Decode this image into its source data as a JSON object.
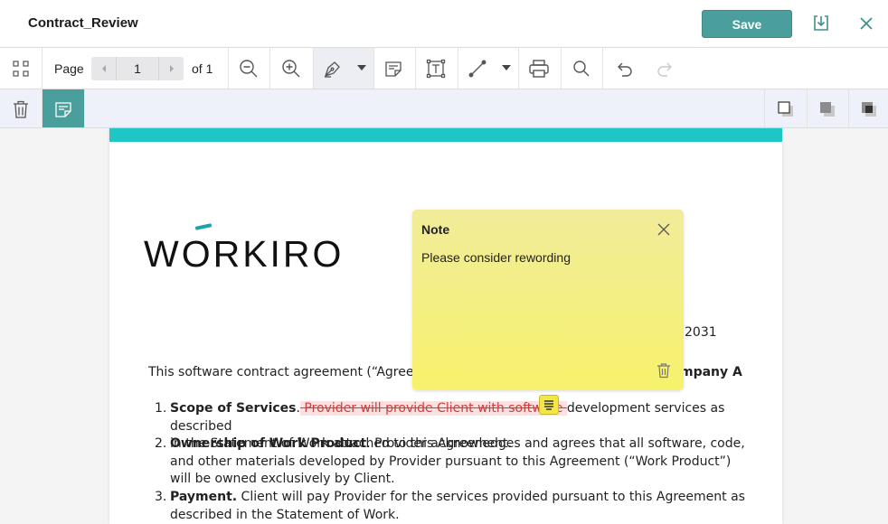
{
  "app": {
    "document_name": "Contract_Review",
    "save_label": "Save"
  },
  "toolbar": {
    "page_label": "Page",
    "page_value": "1",
    "page_of": "of 1"
  },
  "document": {
    "logo": "WORKIRO",
    "date_fragment": "2031",
    "intro_left": "This software contract agreement (“Agreemen",
    "intro_right": "mpany A",
    "clauses": [
      {
        "num": "1.",
        "title": "Scope of Services",
        "struck": " Provider will provide Client with software ",
        "rest_line1": "development services as described",
        "rest_line2": "in the Statement of Work attached to this Agreement."
      },
      {
        "num": "2.",
        "title": "Ownership of Work Product",
        "text": ". Provider acknowledges and agrees that all software, code, and other materials developed by Provider pursuant to this Agreement (“Work Product”) will be owned exclusively by Client."
      },
      {
        "num": "3.",
        "title": "Payment.",
        "text": " Client will pay Provider for the services provided pursuant to this Agreement as described in the Statement of Work."
      }
    ]
  },
  "note": {
    "title": "Note",
    "text": "Please consider rewording"
  },
  "colors": {
    "accent": "#4a9e9c",
    "page_band": "#1fc6c6",
    "note_bg": "#f7f26c",
    "strike": "#d23b3b"
  }
}
